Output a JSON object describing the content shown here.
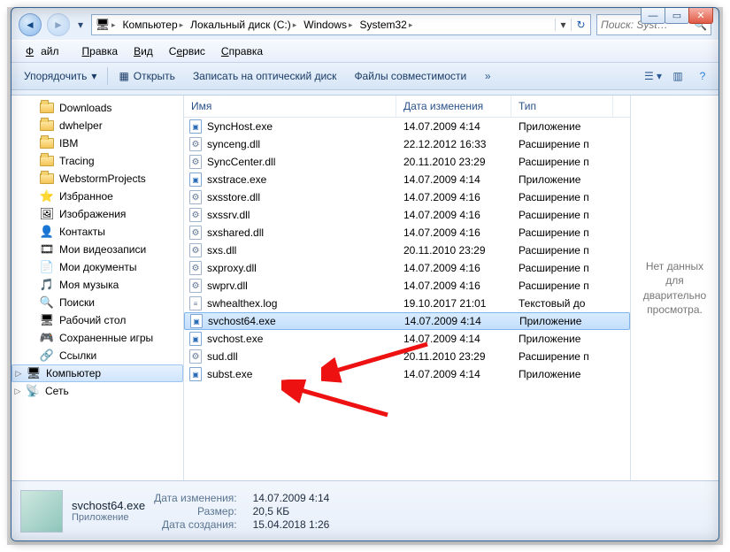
{
  "breadcrumb": {
    "computer": "Компьютер",
    "drive": "Локальный диск (C:)",
    "windows": "Windows",
    "system32": "System32"
  },
  "search": {
    "placeholder": "Поиск: Syst…"
  },
  "menubar": {
    "file": "Файл",
    "edit": "Правка",
    "view": "Вид",
    "tools": "Сервис",
    "help": "Справка"
  },
  "cmdbar": {
    "organize": "Упорядочить",
    "open": "Открыть",
    "burn": "Записать на оптический диск",
    "compat": "Файлы совместимости"
  },
  "tree": [
    {
      "label": "Downloads",
      "icon": "folder"
    },
    {
      "label": "dwhelper",
      "icon": "folder"
    },
    {
      "label": "IBM",
      "icon": "folder"
    },
    {
      "label": "Tracing",
      "icon": "folder"
    },
    {
      "label": "WebstormProjects",
      "icon": "folder"
    },
    {
      "label": "Избранное",
      "icon": "star"
    },
    {
      "label": "Изображения",
      "icon": "pictures"
    },
    {
      "label": "Контакты",
      "icon": "contacts"
    },
    {
      "label": "Мои видеозаписи",
      "icon": "videos"
    },
    {
      "label": "Мои документы",
      "icon": "docs"
    },
    {
      "label": "Моя музыка",
      "icon": "music"
    },
    {
      "label": "Поиски",
      "icon": "search"
    },
    {
      "label": "Рабочий стол",
      "icon": "desktop"
    },
    {
      "label": "Сохраненные игры",
      "icon": "games"
    },
    {
      "label": "Ссылки",
      "icon": "links"
    }
  ],
  "tree_roots": {
    "computer": "Компьютер",
    "network": "Сеть"
  },
  "columns": {
    "name": "Имя",
    "date": "Дата изменения",
    "type": "Тип"
  },
  "files": [
    {
      "name": "SyncHost.exe",
      "date": "14.07.2009 4:14",
      "type": "Приложение",
      "icon": "app"
    },
    {
      "name": "synceng.dll",
      "date": "22.12.2012 16:33",
      "type": "Расширение п",
      "icon": "dll"
    },
    {
      "name": "SyncCenter.dll",
      "date": "20.11.2010 23:29",
      "type": "Расширение п",
      "icon": "dll"
    },
    {
      "name": "sxstrace.exe",
      "date": "14.07.2009 4:14",
      "type": "Приложение",
      "icon": "app"
    },
    {
      "name": "sxsstore.dll",
      "date": "14.07.2009 4:16",
      "type": "Расширение п",
      "icon": "dll"
    },
    {
      "name": "sxssrv.dll",
      "date": "14.07.2009 4:16",
      "type": "Расширение п",
      "icon": "dll"
    },
    {
      "name": "sxshared.dll",
      "date": "14.07.2009 4:16",
      "type": "Расширение п",
      "icon": "dll"
    },
    {
      "name": "sxs.dll",
      "date": "20.11.2010 23:29",
      "type": "Расширение п",
      "icon": "dll"
    },
    {
      "name": "sxproxy.dll",
      "date": "14.07.2009 4:16",
      "type": "Расширение п",
      "icon": "dll"
    },
    {
      "name": "swprv.dll",
      "date": "14.07.2009 4:16",
      "type": "Расширение п",
      "icon": "dll"
    },
    {
      "name": "swhealthex.log",
      "date": "19.10.2017 21:01",
      "type": "Текстовый до",
      "icon": "log"
    },
    {
      "name": "svchost64.exe",
      "date": "14.07.2009 4:14",
      "type": "Приложение",
      "icon": "app",
      "selected": true
    },
    {
      "name": "svchost.exe",
      "date": "14.07.2009 4:14",
      "type": "Приложение",
      "icon": "app"
    },
    {
      "name": "sud.dll",
      "date": "20.11.2010 23:29",
      "type": "Расширение п",
      "icon": "dll"
    },
    {
      "name": "subst.exe",
      "date": "14.07.2009 4:14",
      "type": "Приложение",
      "icon": "app"
    }
  ],
  "preview_text": "Нет данных для дварительно просмотра.",
  "details": {
    "filename": "svchost64.exe",
    "filetype": "Приложение",
    "k_modified": "Дата изменения:",
    "v_modified": "14.07.2009 4:14",
    "k_size": "Размер:",
    "v_size": "20,5 КБ",
    "k_created": "Дата создания:",
    "v_created": "15.04.2018 1:26"
  }
}
